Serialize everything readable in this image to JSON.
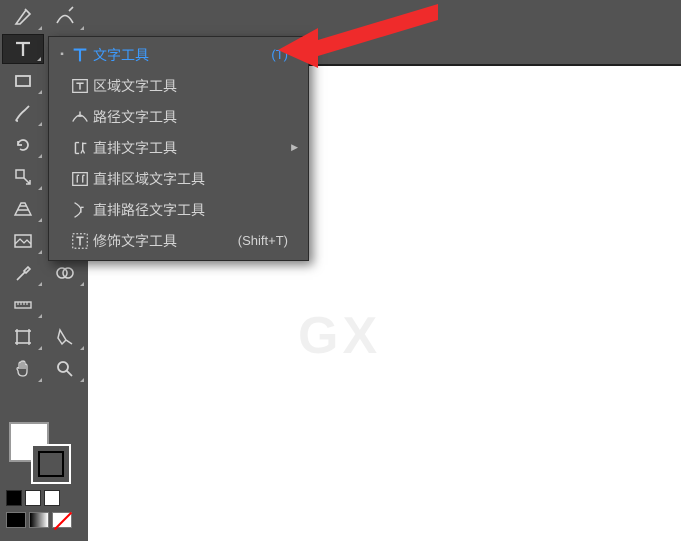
{
  "toolbar": {
    "cols": 2,
    "tools": [
      {
        "id": "anchor-pen",
        "name": "anchor-point-tool"
      },
      {
        "id": "curvature-pen",
        "name": "curvature-tool"
      },
      {
        "id": "type",
        "name": "type-tool",
        "selected": true
      },
      {
        "id": "touch-type",
        "name": "touch-type-tool"
      },
      {
        "id": "rect",
        "name": "rectangle-tool"
      },
      {
        "id": "line",
        "name": "line-segment-tool"
      },
      {
        "id": "brush",
        "name": "paintbrush-tool"
      },
      {
        "id": "pencil",
        "name": "pencil-tool"
      },
      {
        "id": "rotate-ccw",
        "name": "rotate-tool"
      },
      {
        "id": "reflect",
        "name": "reflect-tool"
      },
      {
        "id": "scale",
        "name": "scale-tool"
      },
      {
        "id": "free-transform",
        "name": "free-transform-tool"
      },
      {
        "id": "perspective",
        "name": "perspective-grid-tool"
      },
      {
        "id": "mesh",
        "name": "mesh-tool"
      },
      {
        "id": "image",
        "name": "image-placeholder-tool"
      },
      {
        "id": "graph",
        "name": "column-graph-tool"
      },
      {
        "id": "eyedropper",
        "name": "eyedropper-tool"
      },
      {
        "id": "blend",
        "name": "blend-tool"
      },
      {
        "id": "ruler",
        "name": "ruler-tool"
      },
      {
        "id": "blank1",
        "name": ""
      },
      {
        "id": "artboard",
        "name": "artboard-tool"
      },
      {
        "id": "slice",
        "name": "slice-tool"
      },
      {
        "id": "hand",
        "name": "hand-tool"
      },
      {
        "id": "zoom",
        "name": "zoom-tool"
      }
    ]
  },
  "flyout": {
    "items": [
      {
        "label": "文字工具",
        "short": "(T)",
        "icon": "type",
        "active": true,
        "submenu": false
      },
      {
        "label": "区域文字工具",
        "short": "",
        "icon": "area-type",
        "active": false,
        "submenu": false
      },
      {
        "label": "路径文字工具",
        "short": "",
        "icon": "path-type",
        "active": false,
        "submenu": false
      },
      {
        "label": "直排文字工具",
        "short": "",
        "icon": "vertical-type",
        "active": false,
        "submenu": true
      },
      {
        "label": "直排区域文字工具",
        "short": "",
        "icon": "vertical-area-type",
        "active": false,
        "submenu": false
      },
      {
        "label": "直排路径文字工具",
        "short": "",
        "icon": "vertical-path-type",
        "active": false,
        "submenu": false
      },
      {
        "label": "修饰文字工具",
        "short": "(Shift+T)",
        "icon": "touch-type",
        "active": false,
        "submenu": false
      }
    ]
  },
  "swatch_row": [
    "#000000",
    "#ffffff",
    "#ffffff"
  ],
  "watermark": "GX"
}
